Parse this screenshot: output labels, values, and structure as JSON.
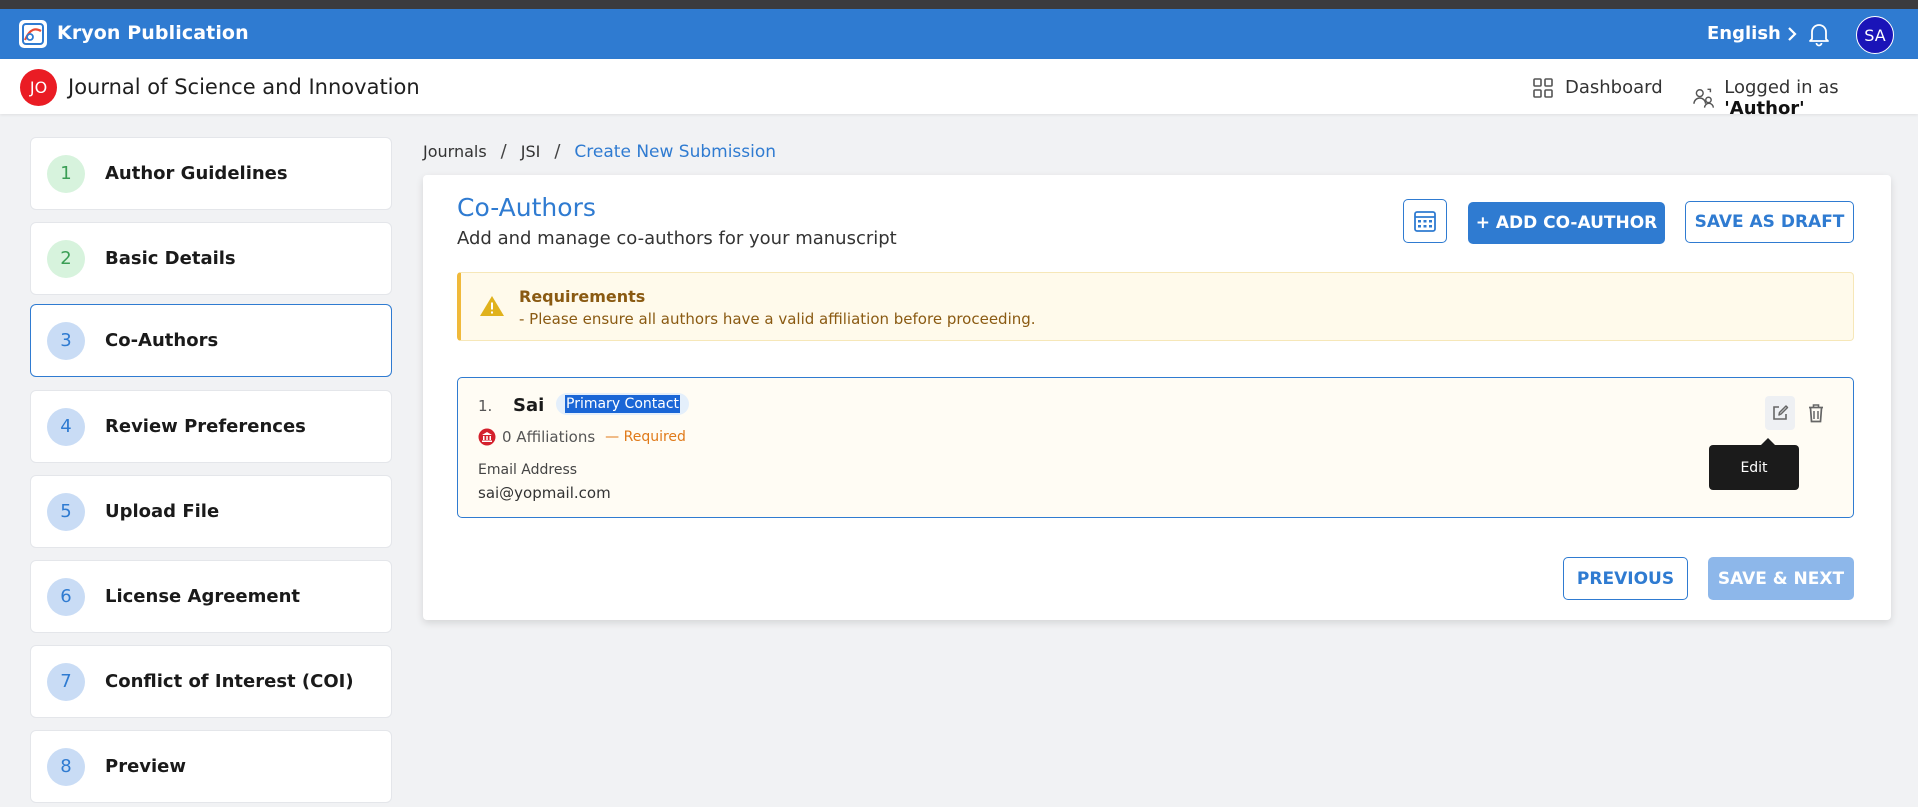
{
  "app": {
    "title": "Kryon Publication",
    "language": "English",
    "avatar_initials": "SA"
  },
  "journal": {
    "initials": "JO",
    "title": "Journal of Science and Innovation",
    "dashboard_label": "Dashboard",
    "logged_in_prefix": "Logged in as ",
    "role": "'Author'"
  },
  "steps": [
    {
      "num": "1",
      "label": "Author Guidelines",
      "status": "done"
    },
    {
      "num": "2",
      "label": "Basic Details",
      "status": "done"
    },
    {
      "num": "3",
      "label": "Co-Authors",
      "status": "active"
    },
    {
      "num": "4",
      "label": "Review Preferences",
      "status": "todo"
    },
    {
      "num": "5",
      "label": "Upload File",
      "status": "todo"
    },
    {
      "num": "6",
      "label": "License Agreement",
      "status": "todo"
    },
    {
      "num": "7",
      "label": "Conflict of Interest (COI)",
      "status": "todo"
    },
    {
      "num": "8",
      "label": "Preview",
      "status": "todo"
    }
  ],
  "breadcrumb": {
    "items": [
      "Journals",
      "JSI",
      "Create New Submission"
    ],
    "separator": "/"
  },
  "page": {
    "title": "Co-Authors",
    "subtitle": "Add and manage co-authors for your manuscript",
    "add_button": "+ ADD CO-AUTHOR",
    "draft_button": "SAVE AS DRAFT",
    "previous_button": "PREVIOUS",
    "next_button": "SAVE & NEXT"
  },
  "requirements": {
    "title": "Requirements",
    "text": "- Please ensure all authors have a valid affiliation before proceeding."
  },
  "authors": [
    {
      "number": "1.",
      "name": "Sai",
      "badge": "Primary Contact",
      "affiliations": "0 Affiliations",
      "required_note": "— Required",
      "email_label": "Email Address",
      "email": "sai@yopmail.com"
    }
  ],
  "tooltip": {
    "text": "Edit"
  },
  "colors": {
    "primary": "#2f7bd1",
    "danger": "#ea1c24",
    "warning": "#f0b93a"
  }
}
